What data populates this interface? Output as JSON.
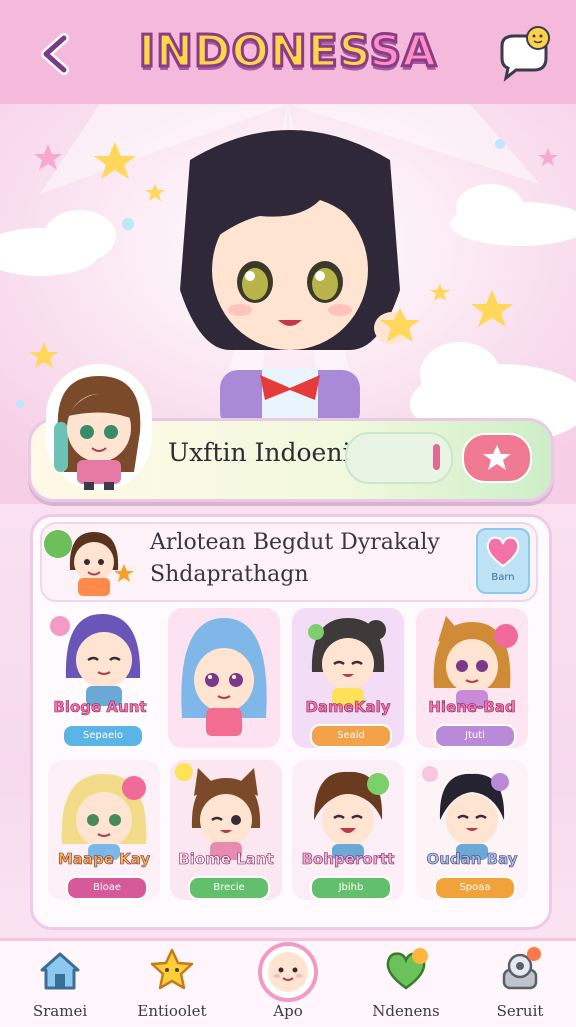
{
  "header": {
    "title_main": "INDONES",
    "title_tail": "SA"
  },
  "banner": {
    "text": "Uxftin Indoenis"
  },
  "featured": {
    "line1": "Arlotean Begdut Dyrakaly",
    "line2": "Shdaprathagn",
    "badge_label": "Barn"
  },
  "characters": [
    {
      "name": "Bloge Aunt",
      "tag": "Sepaeio",
      "tag_color": "#5bb4e6",
      "hair": "#6a55b8"
    },
    {
      "name": "",
      "tag": "",
      "tag_color": "",
      "hair": "#7fb8e8"
    },
    {
      "name": "DameKaly",
      "tag": "Seaid",
      "tag_color": "#f4a24a",
      "hair": "#3f3a3a"
    },
    {
      "name": "Hiene-Bad",
      "tag": "Jtuti",
      "tag_color": "#b98ad8",
      "hair": "#d08b36"
    },
    {
      "name": "Maape Kay",
      "tag": "Bloae",
      "tag_color": "#d65a9a",
      "hair": "#f2dc8a"
    },
    {
      "name": "Biome Lant",
      "tag": "Brecie",
      "tag_color": "#62c06c",
      "hair": "#7a4a2a"
    },
    {
      "name": "Bohperortt",
      "tag": "Jbihb",
      "tag_color": "#62c06c",
      "hair": "#6b3b1f"
    },
    {
      "name": "Oudan Bay",
      "tag": "Spoaa",
      "tag_color": "#f2a23a",
      "hair": "#252330"
    }
  ],
  "nav": [
    {
      "label": "Sramei",
      "icon": "home-icon"
    },
    {
      "label": "Entioolet",
      "icon": "star-icon"
    },
    {
      "label": "Apo",
      "icon": "face-icon"
    },
    {
      "label": "Ndenens",
      "icon": "heart-icon"
    },
    {
      "label": "Seruit",
      "icon": "gear-icon"
    }
  ],
  "colors": {
    "topbar": "#f5b9dc",
    "accent": "#ff6fa8",
    "title": "#ffd84a"
  }
}
